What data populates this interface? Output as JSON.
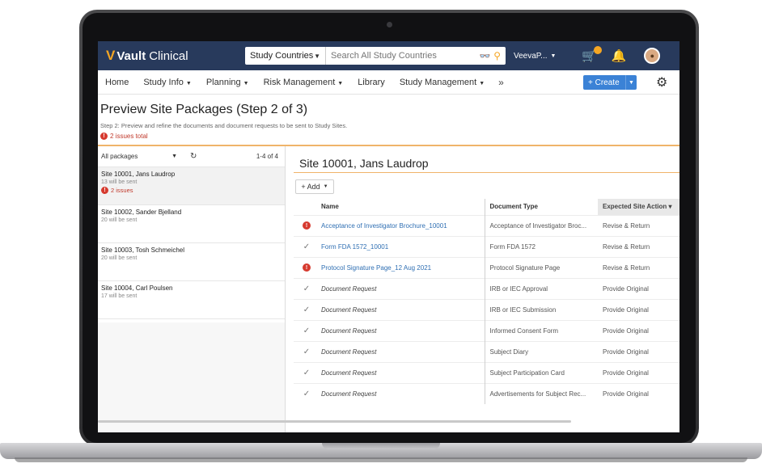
{
  "app": {
    "brand": "Vault",
    "brand_suffix": "Clinical"
  },
  "search": {
    "scope": "Study Countries",
    "placeholder": "Search All Study Countries"
  },
  "topbar": {
    "user": "VeevaP...",
    "icons": [
      "binoculars-icon",
      "search-icon",
      "cart-icon",
      "bell-icon",
      "avatar"
    ]
  },
  "nav": {
    "items": [
      {
        "label": "Home",
        "has_menu": false
      },
      {
        "label": "Study Info",
        "has_menu": true
      },
      {
        "label": "Planning",
        "has_menu": true
      },
      {
        "label": "Risk Management",
        "has_menu": true
      },
      {
        "label": "Library",
        "has_menu": false
      },
      {
        "label": "Study Management",
        "has_menu": true
      }
    ],
    "more": "»",
    "create_label": "+ Create"
  },
  "page": {
    "title": "Preview Site Packages (Step 2 of 3)",
    "subtitle": "Step 2: Preview and refine the documents and document requests to be sent to Study Sites.",
    "issues_total": "2 issues total"
  },
  "packages": {
    "filter": "All packages",
    "count": "1-4 of 4",
    "items": [
      {
        "name": "Site 10001, Jans Laudrop",
        "sent": "13 will be sent",
        "issues": "2 issues"
      },
      {
        "name": "Site 10002, Sander Bjelland",
        "sent": "20 will be sent",
        "issues": ""
      },
      {
        "name": "Site 10003, Tosh Schmeichel",
        "sent": "20 will be sent",
        "issues": ""
      },
      {
        "name": "Site 10004, Carl Poulsen",
        "sent": "17 will be sent",
        "issues": ""
      }
    ]
  },
  "site": {
    "title": "Site 10001, Jans Laudrop",
    "add_label": "+ Add"
  },
  "table": {
    "headers": {
      "name": "Name",
      "doc_type": "Document Type",
      "action": "Expected Site Action ▾"
    },
    "rows": [
      {
        "status": "error",
        "name": "Acceptance of Investigator Brochure_10001",
        "link": true,
        "doc_type": "Acceptance of Investigator Broc...",
        "action": "Revise & Return"
      },
      {
        "status": "ok",
        "name": "Form FDA 1572_10001",
        "link": true,
        "doc_type": "Form FDA 1572",
        "action": "Revise & Return"
      },
      {
        "status": "error",
        "name": "Protocol Signature Page_12 Aug 2021",
        "link": true,
        "doc_type": "Protocol Signature Page",
        "action": "Revise & Return"
      },
      {
        "status": "ok",
        "name": "Document Request",
        "link": false,
        "doc_type": "IRB or IEC Approval",
        "action": "Provide Original"
      },
      {
        "status": "ok",
        "name": "Document Request",
        "link": false,
        "doc_type": "IRB or IEC Submission",
        "action": "Provide Original"
      },
      {
        "status": "ok",
        "name": "Document Request",
        "link": false,
        "doc_type": "Informed Consent Form",
        "action": "Provide Original"
      },
      {
        "status": "ok",
        "name": "Document Request",
        "link": false,
        "doc_type": "Subject Diary",
        "action": "Provide Original"
      },
      {
        "status": "ok",
        "name": "Document Request",
        "link": false,
        "doc_type": "Subject Participation Card",
        "action": "Provide Original"
      },
      {
        "status": "ok",
        "name": "Document Request",
        "link": false,
        "doc_type": "Advertisements for Subject Rec...",
        "action": "Provide Original"
      }
    ]
  },
  "colors": {
    "topbar": "#283a5c",
    "accent": "#f5a623",
    "error": "#d63a2f",
    "link": "#2f6fb3",
    "create": "#3b82d6"
  }
}
